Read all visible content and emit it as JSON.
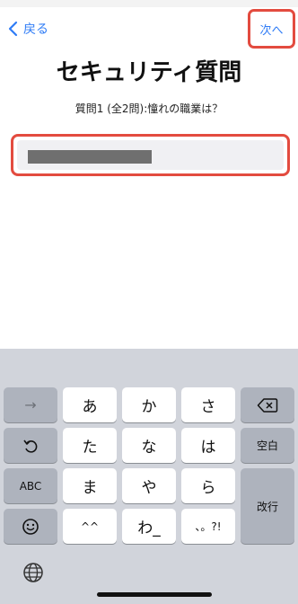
{
  "nav": {
    "back_label": "戻る",
    "next_label": "次へ"
  },
  "page": {
    "title": "セキュリティ質問",
    "question": "質問1 (全2問):憧れの職業は？"
  },
  "answer": {
    "value": "",
    "redacted": true
  },
  "keyboard": {
    "arrow": "→",
    "row1": [
      "あ",
      "か",
      "さ"
    ],
    "row2": [
      "た",
      "な",
      "は"
    ],
    "row3": [
      "ま",
      "や",
      "ら"
    ],
    "row4": [
      "^^",
      "わ_",
      "、。?!"
    ],
    "abc_label": "ABC",
    "space_label": "空白",
    "return_label": "改行",
    "delete_icon": "delete-icon",
    "undo_icon": "undo-icon",
    "emoji_icon": "emoji-icon",
    "globe_icon": "globe-icon"
  },
  "colors": {
    "accent": "#2f7cf6",
    "highlight": "#e34b3f"
  }
}
